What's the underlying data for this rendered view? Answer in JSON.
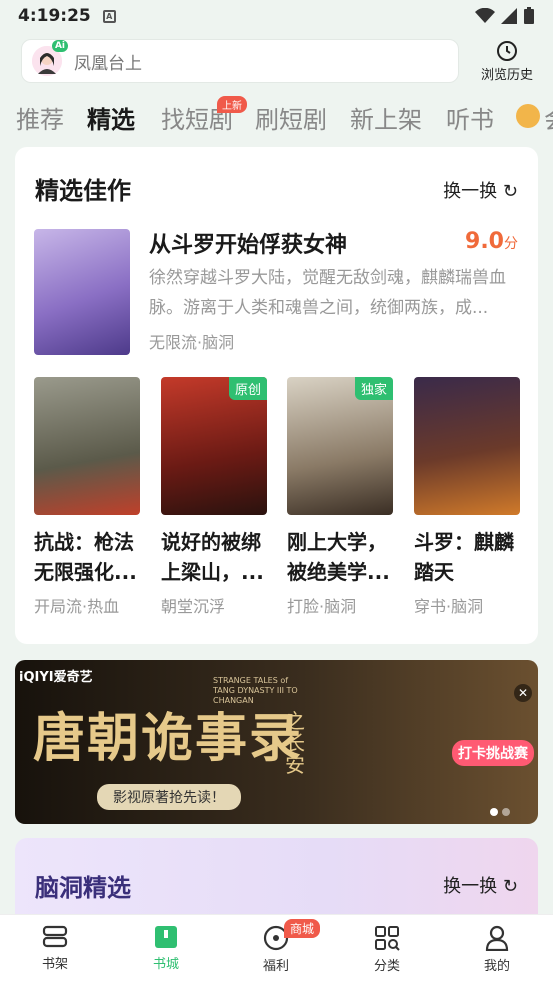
{
  "status_bar": {
    "time": "4:19:25"
  },
  "search": {
    "placeholder": "凤凰台上",
    "ai_badge": "Ai",
    "history_label": "浏览历史"
  },
  "tabs": [
    {
      "label": "推荐",
      "active": false
    },
    {
      "label": "精选",
      "active": true
    },
    {
      "label": "找短剧",
      "active": false,
      "badge": "上新"
    },
    {
      "label": "刷短剧",
      "active": false
    },
    {
      "label": "新上架",
      "active": false
    },
    {
      "label": "听书",
      "active": false
    },
    {
      "label": "会",
      "active": false
    }
  ],
  "featured_section": {
    "title": "精选佳作",
    "refresh_label": "换一换",
    "top_book": {
      "title": "从斗罗开始俘获女神",
      "score": "9.0",
      "score_unit": "分",
      "description": "徐然穿越斗罗大陆，觉醒无敌剑魂，麒麟瑞兽血脉。游离于人类和魂兽之间，统御两族，成...",
      "tags": "无限流·脑洞"
    },
    "books": [
      {
        "title": "抗战：枪法无限强化...",
        "tags": "开局流·热血",
        "label": ""
      },
      {
        "title": "说好的被绑上梁山，...",
        "tags": "朝堂沉浮",
        "label": "原创"
      },
      {
        "title": "刚上大学，被绝美学...",
        "tags": "打脸·脑洞",
        "label": "独家"
      },
      {
        "title": "斗罗：麒麟踏天",
        "tags": "穿书·脑洞",
        "label": ""
      }
    ]
  },
  "banner": {
    "brand": "iQIYI爱奇艺",
    "headline": "唐朝诡事录",
    "subtitle_vertical": "之长安",
    "english_title": "STRANGE TALES of TANG DYNASTY III TO CHANGAN",
    "tagline": "影视原著抢先读！",
    "promo": "打卡挑战赛"
  },
  "brain_section": {
    "title": "脑洞精选",
    "refresh_label": "换一换"
  },
  "bottom_nav": [
    {
      "label": "书架",
      "icon": "bookshelf-icon",
      "active": false
    },
    {
      "label": "书城",
      "icon": "bookstore-icon",
      "active": true
    },
    {
      "label": "福利",
      "icon": "welfare-icon",
      "active": false,
      "badge": "商城"
    },
    {
      "label": "分类",
      "icon": "category-icon",
      "active": false
    },
    {
      "label": "我的",
      "icon": "profile-icon",
      "active": false
    }
  ],
  "colors": {
    "accent": "#2fbf71",
    "score": "#f06a3a",
    "badge_red": "#f05a4a"
  }
}
